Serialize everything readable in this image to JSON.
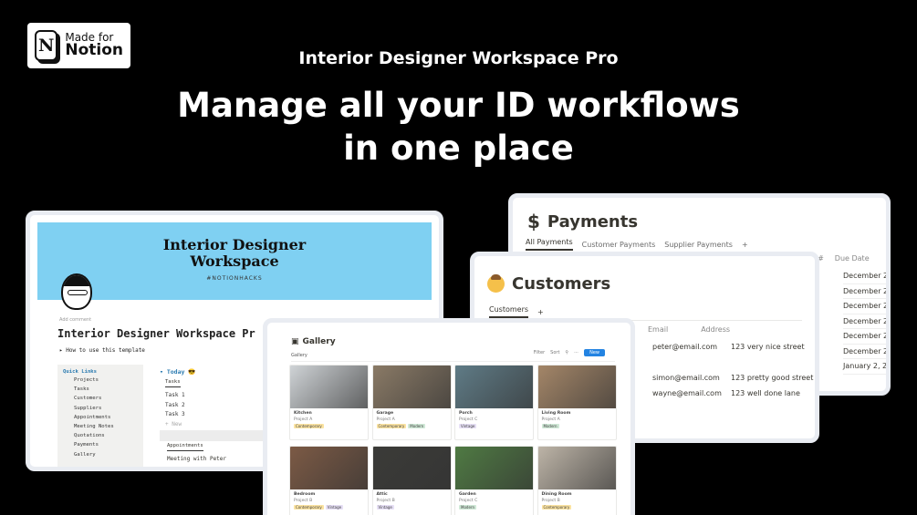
{
  "badge": {
    "line1": "Made for",
    "line2": "Notion",
    "logo_letter": "N"
  },
  "subtitle": "Interior Designer Workspace Pro",
  "headline": {
    "line1": "Manage all your ID workflows",
    "line2": "in one place"
  },
  "payments": {
    "title": "Payments",
    "tabs": [
      "All Payments",
      "Customer Payments",
      "Supplier Payments"
    ],
    "add": "+",
    "col_invoice": "ice #",
    "col_due": "Due Date",
    "dates": [
      "December 2",
      "December 2",
      "December 2",
      "December 2",
      "December 2",
      "December 2",
      "January 2, 2"
    ]
  },
  "customers": {
    "title": "Customers",
    "tab": "Customers",
    "add": "+",
    "col_email": "Email",
    "col_address": "Address",
    "rows": [
      {
        "email": "peter@email.com",
        "address": "123 very nice street"
      },
      {
        "email": "",
        "address": ""
      },
      {
        "email": "simon@email.com",
        "address": "123 pretty good street"
      },
      {
        "email": "wayne@email.com",
        "address": "123 well done lane"
      }
    ]
  },
  "workspace": {
    "banner_title_1": "Interior Designer",
    "banner_title_2": "Workspace",
    "banner_tag": "#NOTIONHACKS",
    "add_comment": "Add comment",
    "page_title": "Interior Designer Workspace Pr",
    "how_to": "▸ How to use this template",
    "quick_links": "Quick Links",
    "links": [
      "Projects",
      "Tasks",
      "Customers",
      "Suppliers",
      "Appointments",
      "Meeting Notes",
      "Quotations",
      "Payments",
      "Gallery"
    ],
    "today": "▾ Today 😎",
    "tasks_tab": "Tasks",
    "tasks": [
      "Task 1",
      "Task 2",
      "Task 3"
    ],
    "new_task": "+ New",
    "appointments_tab": "Appointments",
    "meeting": "Meeting with Peter"
  },
  "gallery": {
    "title": "Gallery",
    "tab": "Gallery",
    "controls": [
      "Filter",
      "Sort",
      "⚲",
      "⋯"
    ],
    "new_button": "New",
    "items": [
      {
        "name": "Kitchen",
        "project": "Project A",
        "tags": [
          "Contemporary"
        ],
        "color": "#cfd3d6"
      },
      {
        "name": "Garage",
        "project": "Project A",
        "tags": [
          "Contemporary",
          "Modern"
        ],
        "color": "#8a7a66"
      },
      {
        "name": "Porch",
        "project": "Project C",
        "tags": [
          "Vintage"
        ],
        "color": "#5f7b86"
      },
      {
        "name": "Living Room",
        "project": "Project A",
        "tags": [
          "Modern"
        ],
        "color": "#a48668"
      },
      {
        "name": "Bedroom",
        "project": "Project B",
        "tags": [
          "Contemporary",
          "Vintage"
        ],
        "color": "#7c5a45"
      },
      {
        "name": "Attic",
        "project": "Project B",
        "tags": [
          "Vintage"
        ],
        "color": "#3b3b38"
      },
      {
        "name": "Garden",
        "project": "Project C",
        "tags": [
          "Modern"
        ],
        "color": "#4f7a43"
      },
      {
        "name": "Dining Room",
        "project": "Project B",
        "tags": [
          "Contemporary"
        ],
        "color": "#bdb4a7"
      }
    ]
  }
}
